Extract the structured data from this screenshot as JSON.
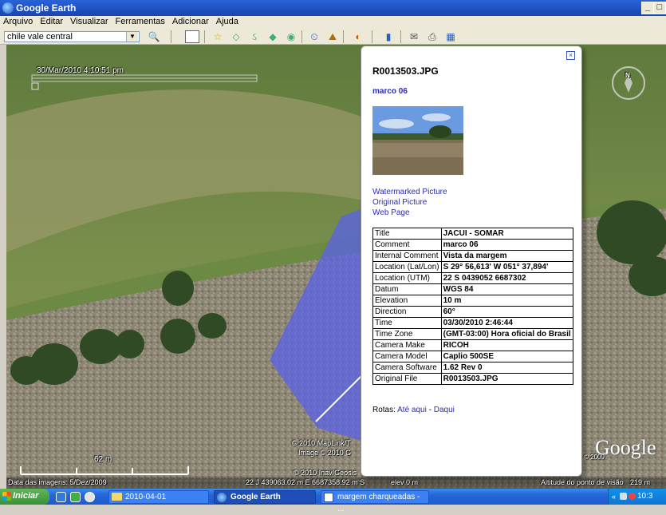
{
  "window": {
    "title": "Google Earth",
    "min_label": "_",
    "restore_label": "□"
  },
  "menu": [
    "Arquivo",
    "Editar",
    "Visualizar",
    "Ferramentas",
    "Adicionar",
    "Ajuda"
  ],
  "search": {
    "value": "chile vale central"
  },
  "map": {
    "time_stamp": "30/Mar/2010  4:10:51 pm",
    "copyright_1": "© 2010 MapLink/T",
    "copyright_2": "Image © 2010 G",
    "copyright_3": "© 2010 Inav/Geosis",
    "logo": "Google",
    "logo_year": "© 2009",
    "scale_label": "62 m",
    "status_date": "Data das imagens: 5/Dez/2009",
    "status_coords": "22 J 439063.02 m E 6687358.92 m S",
    "status_elev": "elev   0 m",
    "status_eye": "Altitude do ponto de visão",
    "status_eye_val": "219 m",
    "compass_n": "N"
  },
  "balloon": {
    "close": "×",
    "title": "R0013503.JPG",
    "subtitle": "marco 06",
    "links": [
      "Watermarked Picture",
      "Original Picture",
      "Web Page"
    ],
    "table": [
      {
        "key": "Title",
        "value": "JACUI - SOMAR"
      },
      {
        "key": "Comment",
        "value": "marco 06"
      },
      {
        "key": "Internal Comment",
        "value": "Vista da margem"
      },
      {
        "key": "Location (Lat/Lon)",
        "value": "S 29° 56,613' W 051° 37,894'"
      },
      {
        "key": "Location (UTM)",
        "value": "22 S 0439052 6687302"
      },
      {
        "key": "Datum",
        "value": "WGS 84"
      },
      {
        "key": "Elevation",
        "value": "10 m"
      },
      {
        "key": "Direction",
        "value": "60°"
      },
      {
        "key": "Time",
        "value": "03/30/2010 2:46:44"
      },
      {
        "key": "Time Zone",
        "value": "(GMT-03:00) Hora oficial do Brasil"
      },
      {
        "key": "Camera Make",
        "value": "RICOH"
      },
      {
        "key": "Camera Model",
        "value": "Caplio 500SE"
      },
      {
        "key": "Camera Software",
        "value": "1.62 Rev 0"
      },
      {
        "key": "Original File",
        "value": "R0013503.JPG"
      }
    ],
    "rotas_label": "Rotas:",
    "rotas_link1": "Até aqui",
    "rotas_sep": " - ",
    "rotas_link2": "Daqui"
  },
  "taskbar": {
    "start": "Iniciar",
    "tasks": [
      "2010-04-01",
      "Google Earth",
      "margem charqueadas - ..."
    ],
    "tray_time": "10:3"
  }
}
